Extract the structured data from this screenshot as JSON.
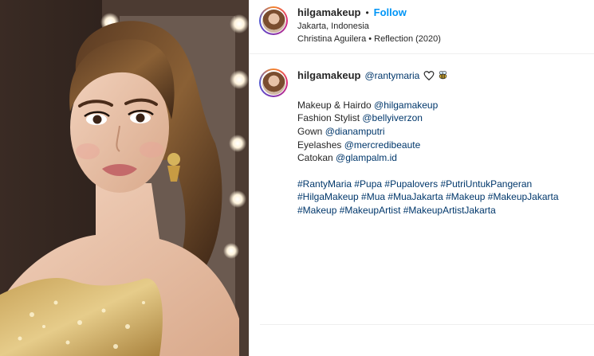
{
  "post": {
    "author": "hilgamakeup",
    "follow_label": "Follow",
    "dot": "•",
    "location": "Jakarta, Indonesia",
    "audio": "Christina Aguilera • Reflection (2020)"
  },
  "caption": {
    "author": "hilgamakeup",
    "lead_mention": "@rantymaria",
    "credits": [
      {
        "label": "Makeup & Hairdo ",
        "handle": "@hilgamakeup"
      },
      {
        "label": "Fashion Stylist ",
        "handle": "@bellyiverzon"
      },
      {
        "label": "Gown ",
        "handle": "@dianamputri"
      },
      {
        "label": "Eyelashes ",
        "handle": "@mercredibeaute"
      },
      {
        "label": "Catokan ",
        "handle": "@glampalm.id"
      }
    ],
    "hashtag_lines": [
      "#RantyMaria #Pupa #Pupalovers #PutriUntukPangeran",
      "#HilgaMakeup #Mua #MuaJakarta #Makeup #MakeupJakarta",
      "#Makeup #MakeupArtist #MakeupArtistJakarta"
    ]
  },
  "colors": {
    "link": "#0095f6",
    "mention": "#00376b",
    "text": "#262626",
    "border": "#efefef"
  }
}
